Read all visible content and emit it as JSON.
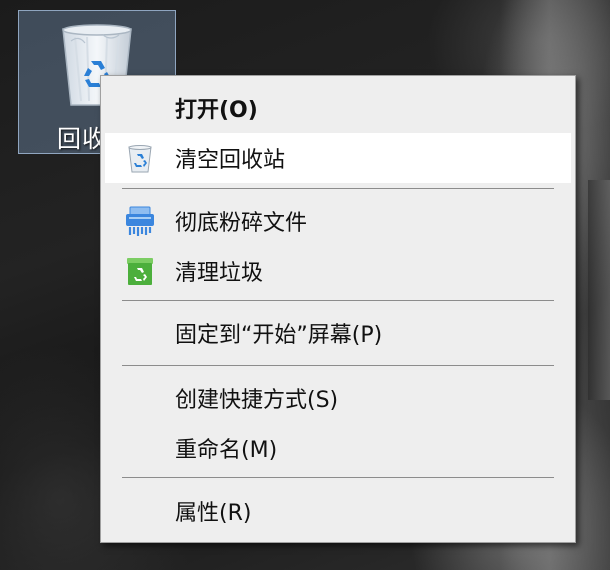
{
  "desktop": {
    "icon_label": "回收",
    "icon_name": "recycle-bin-icon"
  },
  "menu": {
    "items": [
      {
        "label": "打开(O)",
        "bold": true,
        "highlighted": false,
        "icon": null
      },
      {
        "label": "清空回收站",
        "bold": false,
        "highlighted": true,
        "icon": "recycle-bin-small-icon"
      },
      {
        "label": "彻底粉碎文件",
        "bold": false,
        "highlighted": false,
        "icon": "shredder-icon"
      },
      {
        "label": "清理垃圾",
        "bold": false,
        "highlighted": false,
        "icon": "green-trash-icon"
      },
      {
        "label": "固定到“开始”屏幕(P)",
        "bold": false,
        "highlighted": false,
        "icon": null
      },
      {
        "label": "创建快捷方式(S)",
        "bold": false,
        "highlighted": false,
        "icon": null
      },
      {
        "label": "重命名(M)",
        "bold": false,
        "highlighted": false,
        "icon": null
      },
      {
        "label": "属性(R)",
        "bold": false,
        "highlighted": false,
        "icon": null
      }
    ]
  },
  "colors": {
    "menu_background": "#eeeeee",
    "highlight": "#ffffff",
    "recycle_blue": "#2a7fd6",
    "shredder_blue": "#3b86de",
    "trash_green": "#4caf3c"
  }
}
